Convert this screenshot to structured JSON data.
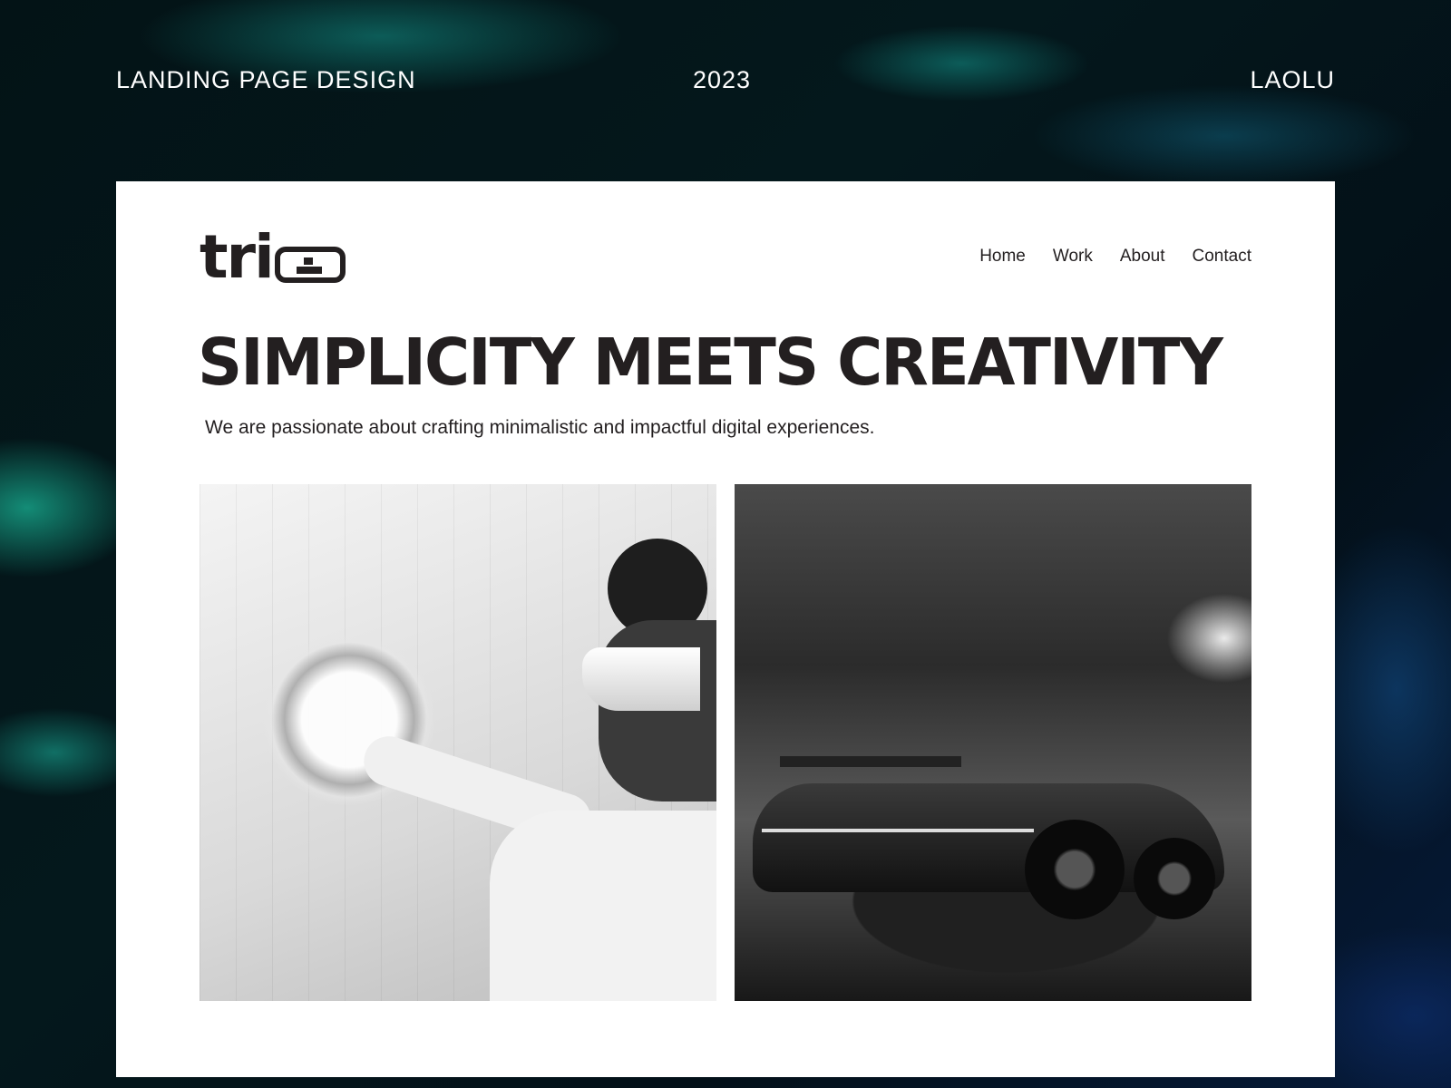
{
  "header": {
    "left": "LANDING PAGE DESIGN",
    "center": "2023",
    "right": "LAOLU"
  },
  "brand": {
    "logo_text": "tri"
  },
  "nav": {
    "items": [
      {
        "label": "Home"
      },
      {
        "label": "Work"
      },
      {
        "label": "About"
      },
      {
        "label": "Contact"
      }
    ]
  },
  "hero": {
    "headline": "SIMPLICITY MEETS CREATIVITY",
    "subtitle": "We are passionate about crafting minimalistic and impactful digital experiences."
  },
  "gallery": {
    "images": [
      {
        "subject": "person-touching-bubble"
      },
      {
        "subject": "sports-car"
      }
    ]
  },
  "colors": {
    "text": "#231f20",
    "card": "#ffffff",
    "background_accent": "#14a08c"
  }
}
